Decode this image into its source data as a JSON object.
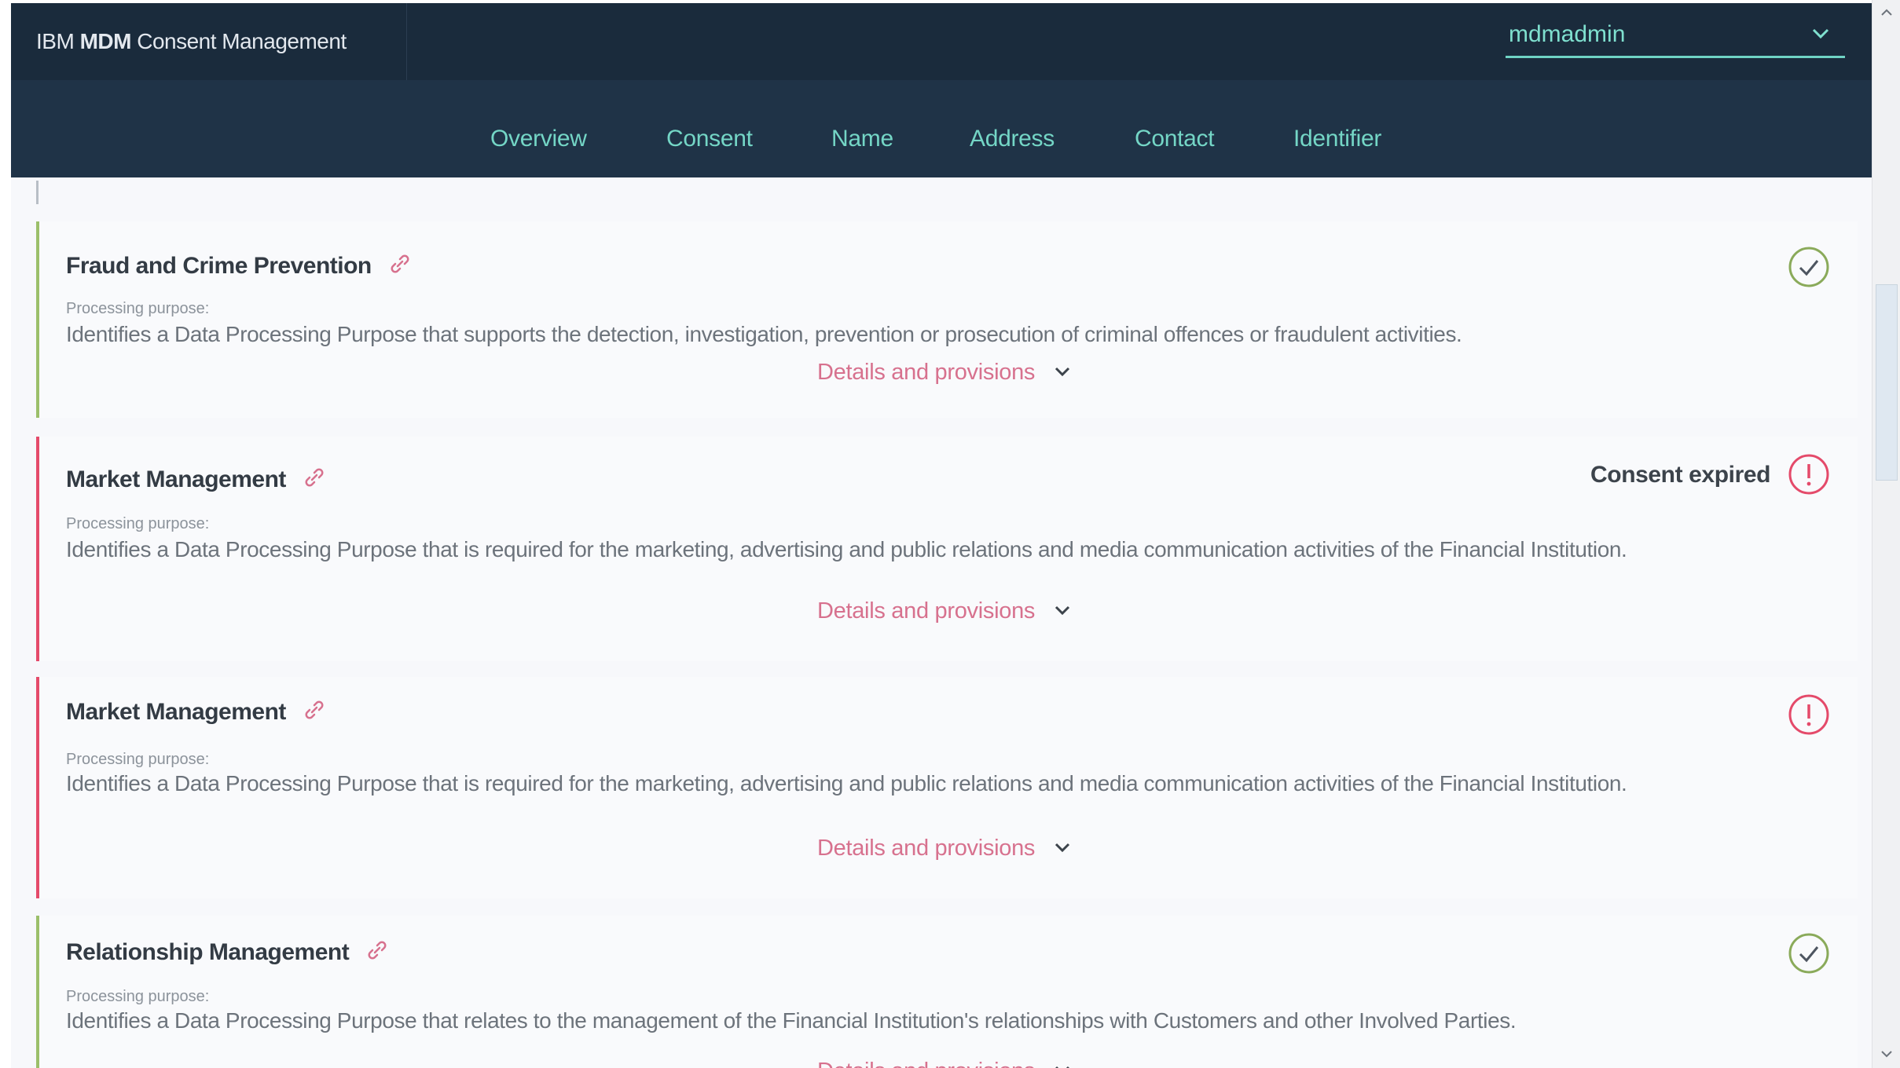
{
  "header": {
    "brand_prefix": "IBM ",
    "brand_bold": "MDM",
    "brand_suffix": " Consent Management",
    "user": "mdmadmin"
  },
  "nav": {
    "items": [
      "Overview",
      "Consent",
      "Name",
      "Address",
      "Contact",
      "Identifier"
    ]
  },
  "cards": [
    {
      "title": "Fraud and Crime Prevention",
      "purpose_label": "Processing purpose:",
      "purpose_text": "Identifies a Data Processing Purpose that supports the detection, investigation, prevention or prosecution of criminal offences or fraudulent activities.",
      "details_label": "Details and provisions",
      "status": "valid",
      "status_text": ""
    },
    {
      "title": "Market Management",
      "purpose_label": "Processing purpose:",
      "purpose_text": "Identifies a Data Processing Purpose that is required for the marketing, advertising and public relations and media communication activities of the Financial Institution.",
      "details_label": "Details and provisions",
      "status": "expired",
      "status_text": "Consent expired"
    },
    {
      "title": "Market Management",
      "purpose_label": "Processing purpose:",
      "purpose_text": "Identifies a Data Processing Purpose that is required for the marketing, advertising and public relations and media communication activities of the Financial Institution.",
      "details_label": "Details and provisions",
      "status": "expired",
      "status_text": ""
    },
    {
      "title": "Relationship Management",
      "purpose_label": "Processing purpose:",
      "purpose_text": "Identifies a Data Processing Purpose that relates to the management of the Financial Institution's relationships with Customers and other Involved Parties.",
      "details_label": "Details and provisions",
      "status": "valid",
      "status_text": ""
    }
  ],
  "colors": {
    "topbar": "#1a2b3c",
    "navbar": "#1f3347",
    "accent_teal": "#74d6c6",
    "valid_green": "#9bbf6a",
    "expired_red": "#e44a6a",
    "details_pink": "#d7718e"
  },
  "icons": {
    "link": "link-icon",
    "valid": "check-circle-icon",
    "expired": "exclamation-circle-icon",
    "details": "chevron-down-icon"
  }
}
